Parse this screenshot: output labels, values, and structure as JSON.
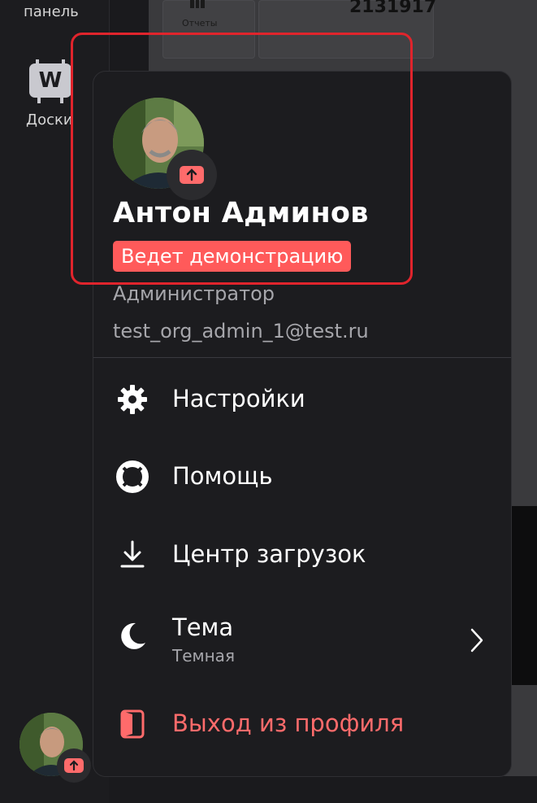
{
  "sidebar": {
    "panel_label": "панель",
    "boards_label": "Доски"
  },
  "background": {
    "reports_label": "Отчеты",
    "metric_value": "2131917"
  },
  "profile": {
    "name": "Антон Админов",
    "status_badge": "Ведет демонстрацию",
    "role": "Администратор",
    "email": "test_org_admin_1@test.ru"
  },
  "menu": {
    "items": [
      {
        "label": "Настройки",
        "icon": "gear-icon"
      },
      {
        "label": "Помощь",
        "icon": "lifebuoy-icon"
      },
      {
        "label": "Центр загрузок",
        "icon": "download-icon"
      },
      {
        "label": "Тема",
        "sublabel": "Темная",
        "icon": "moon-icon"
      },
      {
        "label": "Выход из профиля",
        "icon": "logout-door-icon"
      }
    ]
  },
  "colors": {
    "accent_red": "#ff5a5a",
    "highlight_border": "#e0242c",
    "menu_bg": "#1c1c1f"
  }
}
